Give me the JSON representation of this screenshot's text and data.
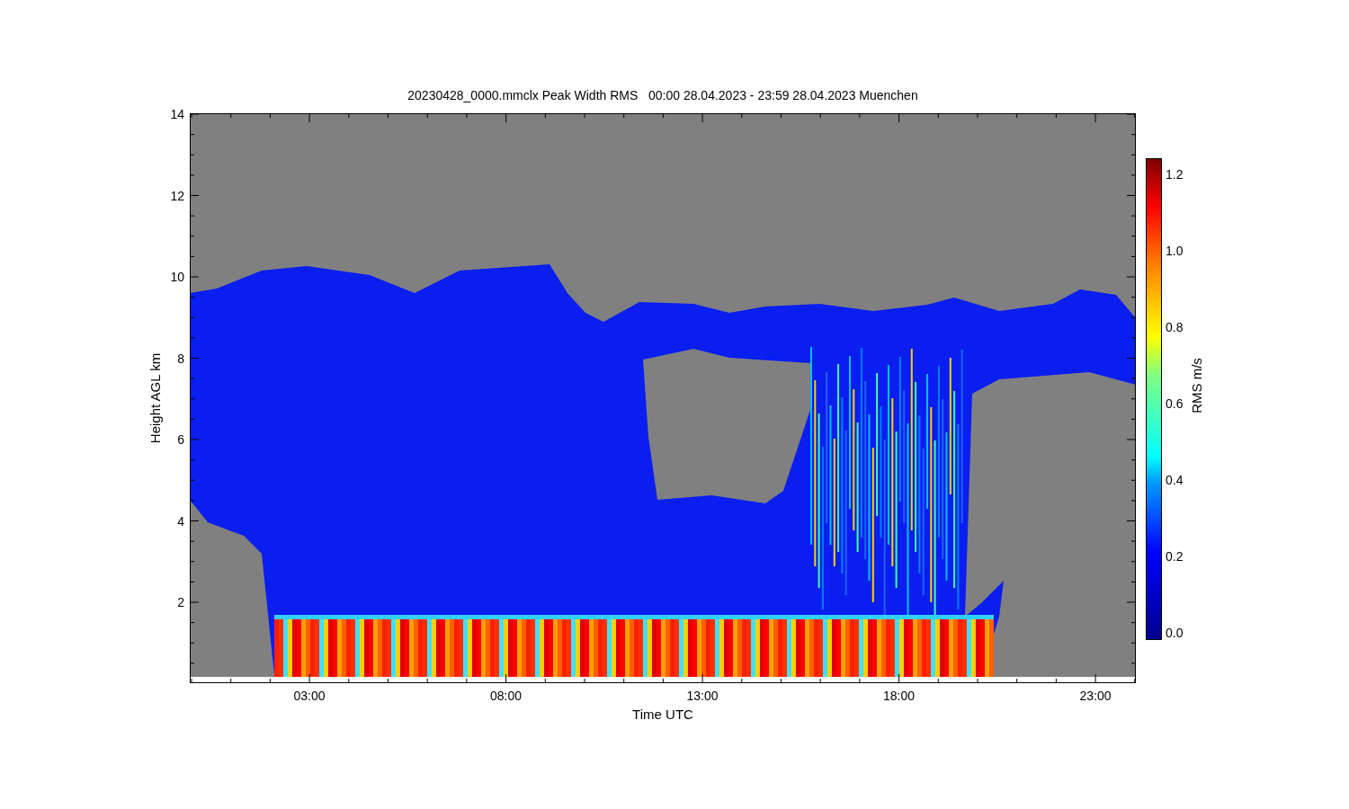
{
  "title": "20230428_0000.mmclx Peak Width RMS   00:00 28.04.2023 - 23:59 28.04.2023 Muenchen",
  "y_axis": {
    "label": "Height AGL km",
    "ticks": [
      "14",
      "12",
      "10",
      "8",
      "6",
      "4",
      "2"
    ]
  },
  "x_axis": {
    "label": "Time UTC",
    "ticks": [
      "03:00",
      "08:00",
      "13:00",
      "18:00",
      "23:00"
    ]
  },
  "colorbar": {
    "label": "RMS m/s",
    "ticks": [
      "1.2",
      "1.0",
      "0.8",
      "0.6",
      "0.4",
      "0.2",
      "0.0"
    ]
  }
}
